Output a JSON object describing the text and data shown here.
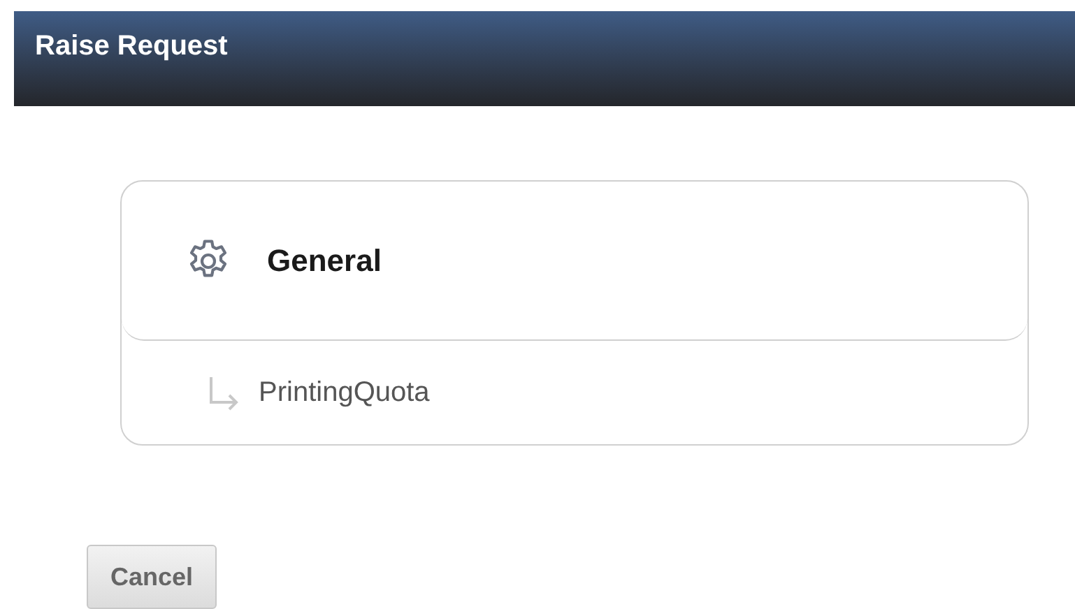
{
  "window": {
    "title": "Raise Request"
  },
  "category": {
    "title": "General",
    "children": [
      {
        "label": "PrintingQuota"
      }
    ]
  },
  "buttons": [
    {
      "label": "Cancel"
    }
  ]
}
